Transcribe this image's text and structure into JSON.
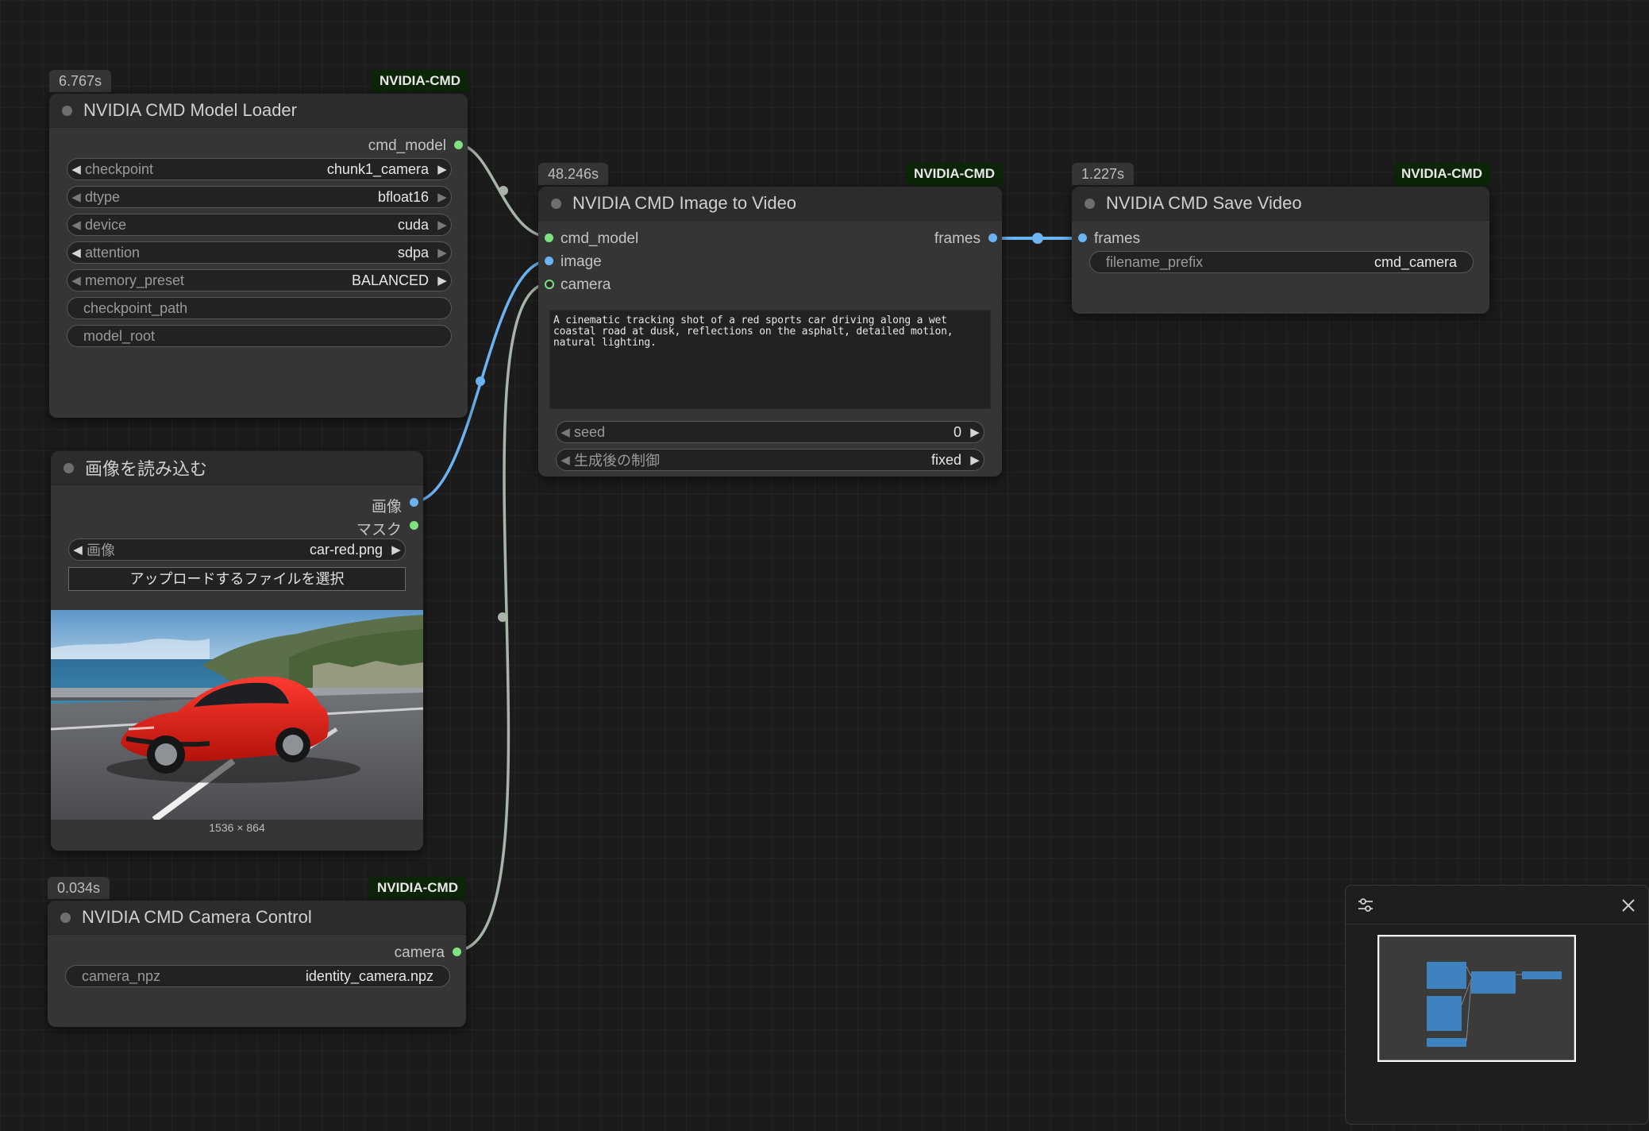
{
  "nodes": {
    "model_loader": {
      "time": "6.767s",
      "tag": "NVIDIA-CMD",
      "title": "NVIDIA CMD Model Loader",
      "output": "cmd_model",
      "widgets": [
        {
          "label": "checkpoint",
          "value": "chunk1_camera"
        },
        {
          "label": "dtype",
          "value": "bfloat16"
        },
        {
          "label": "device",
          "value": "cuda"
        },
        {
          "label": "attention",
          "value": "sdpa"
        },
        {
          "label": "memory_preset",
          "value": "BALANCED"
        }
      ],
      "text_widgets": [
        "checkpoint_path",
        "model_root"
      ]
    },
    "load_image": {
      "title": "画像を読み込む",
      "outputs": [
        "画像",
        "マスク"
      ],
      "widget": {
        "label": "画像",
        "value": "car-red.png"
      },
      "upload_label": "アップロードするファイルを選択",
      "image_size": "1536 × 864"
    },
    "camera_control": {
      "time": "0.034s",
      "tag": "NVIDIA-CMD",
      "title": "NVIDIA CMD Camera Control",
      "output": "camera",
      "widget": {
        "label": "camera_npz",
        "value": "identity_camera.npz"
      }
    },
    "image_to_video": {
      "time": "48.246s",
      "tag": "NVIDIA-CMD",
      "title": "NVIDIA CMD Image to Video",
      "inputs": [
        "cmd_model",
        "image",
        "camera"
      ],
      "output": "frames",
      "prompt": "A cinematic tracking shot of a red sports car driving along a wet coastal road at dusk, reflections on the asphalt, detailed motion, natural lighting.",
      "widgets": [
        {
          "label": "seed",
          "value": "0"
        },
        {
          "label": "生成後の制御",
          "value": "fixed"
        }
      ]
    },
    "save_video": {
      "time": "1.227s",
      "tag": "NVIDIA-CMD",
      "title": "NVIDIA CMD Save Video",
      "input": "frames",
      "widget": {
        "label": "filename_prefix",
        "value": "cmd_camera"
      }
    }
  },
  "minimap": {
    "settings_icon": "sliders-icon",
    "close_icon": "close-icon"
  },
  "colors": {
    "model_link": "#a8b4a8",
    "image_link": "#6cb3f2",
    "frames_link": "#6cb3f2",
    "camera_link": "#a8b4a8"
  }
}
